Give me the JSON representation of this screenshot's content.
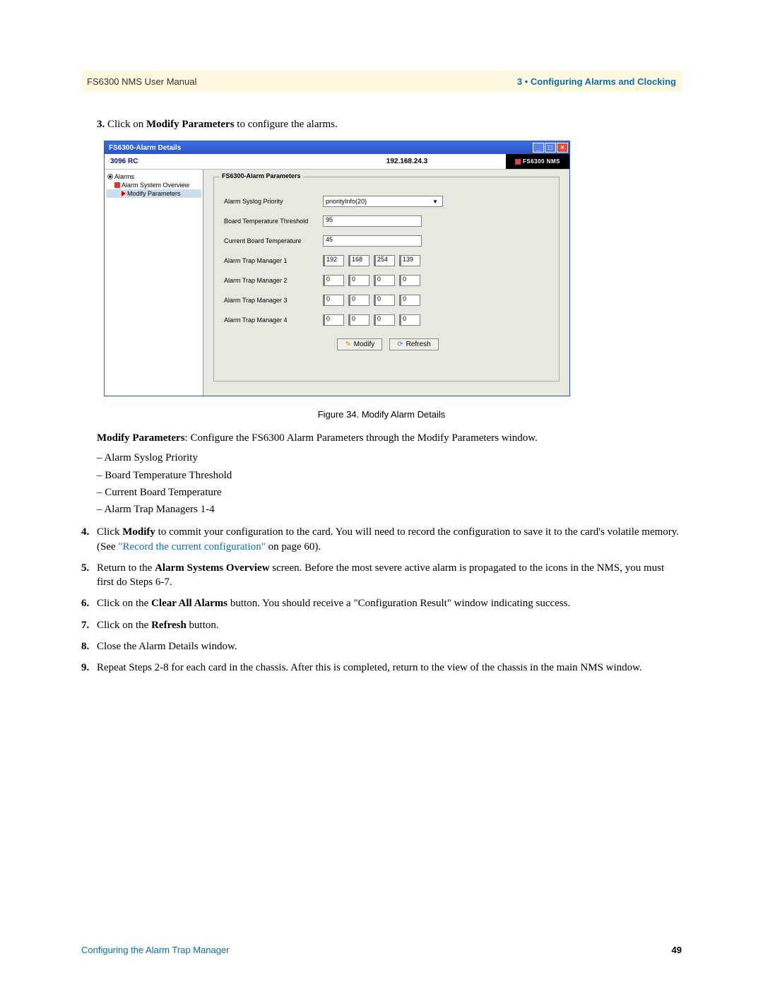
{
  "header": {
    "manual": "FS6300 NMS User Manual",
    "section": "3 • Configuring Alarms and Clocking"
  },
  "step3": {
    "num": "3.",
    "pre": "Click on ",
    "bold": "Modify Parameters",
    "post": " to configure the alarms."
  },
  "window": {
    "title": "FS6300-Alarm Details",
    "device": "3096 RC",
    "ip": "192.168.24.3",
    "brand": "FS6300 NMS",
    "nav": {
      "root": "Alarms",
      "child1": "Alarm System Overview",
      "child2": "Modify Parameters"
    },
    "form": {
      "legend": "FS6300-Alarm Parameters",
      "syslog_label": "Alarm Syslog Priority",
      "syslog_value": "priorityInfo(20)",
      "temp_thresh_label": "Board Temperature Threshold",
      "temp_thresh_value": "95",
      "cur_temp_label": "Current Board Temperature",
      "cur_temp_value": "45",
      "tm1": {
        "label": "Alarm Trap Manager 1",
        "o1": "192",
        "o2": "168",
        "o3": "254",
        "o4": "139"
      },
      "tm2": {
        "label": "Alarm Trap Manager 2",
        "o1": "0",
        "o2": "0",
        "o3": "0",
        "o4": "0"
      },
      "tm3": {
        "label": "Alarm Trap Manager 3",
        "o1": "0",
        "o2": "0",
        "o3": "0",
        "o4": "0"
      },
      "tm4": {
        "label": "Alarm Trap Manager 4",
        "o1": "0",
        "o2": "0",
        "o3": "0",
        "o4": "0"
      },
      "modify_btn": "Modify",
      "refresh_btn": "Refresh"
    }
  },
  "caption": "Figure 34. Modify Alarm Details",
  "para_modify": {
    "lead_bold": "Modify Parameters",
    "lead_rest": ": Configure the FS6300 Alarm Parameters through the Modify Parameters window.",
    "b1": "Alarm Syslog Priority",
    "b2": "Board Temperature Threshold",
    "b3": "Current Board Temperature",
    "b4": "Alarm Trap Managers 1-4"
  },
  "step4": {
    "num": "4.",
    "t1": "Click ",
    "b1": "Modify",
    "t2": " to commit your configuration to the card. You will need to record the configuration to save it to the card's volatile memory. (See ",
    "link": "\"Record the current configuration\"",
    "t3": " on page 60)."
  },
  "step5": {
    "num": "5.",
    "t1": "Return to the ",
    "b1": "Alarm Systems Overview",
    "t2": " screen. Before the most severe active alarm is propagated to the icons in the NMS, you must first do Steps 6-7."
  },
  "step6": {
    "num": "6.",
    "t1": "Click on the ",
    "b1": "Clear All Alarms",
    "t2": " button. You should receive a \"Configuration Result\" window indicating success."
  },
  "step7": {
    "num": "7.",
    "t1": "Click on the ",
    "b1": "Refresh",
    "t2": " button."
  },
  "step8": {
    "num": "8.",
    "t1": "Close the Alarm Details window."
  },
  "step9": {
    "num": "9.",
    "t1": "Repeat Steps 2-8 for each card in the chassis. After this is completed, return to the view of the chassis in the main NMS window."
  },
  "footer": {
    "left": "Configuring the Alarm Trap Manager",
    "page": "49"
  }
}
